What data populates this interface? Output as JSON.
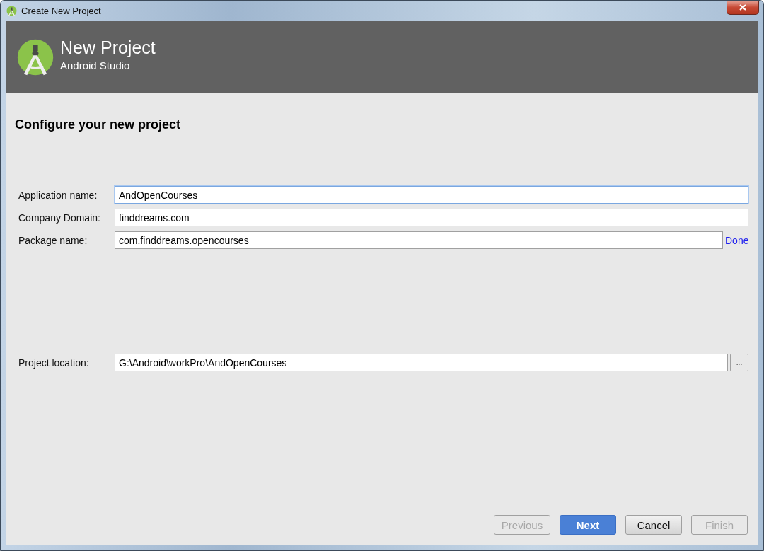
{
  "window": {
    "title": "Create New Project"
  },
  "header": {
    "title": "New Project",
    "subtitle": "Android Studio"
  },
  "page_title": "Configure your new project",
  "fields": [
    {
      "label": "Application name:",
      "value": "AndOpenCourses",
      "focused": true
    },
    {
      "label": "Company Domain:",
      "value": "finddreams.com",
      "focused": false
    },
    {
      "label": "Package name:",
      "value": "com.finddreams.opencourses",
      "focused": false,
      "link": "Done"
    }
  ],
  "location": {
    "label": "Project location:",
    "value": "G:\\Android\\workPro\\AndOpenCourses",
    "focused": false,
    "browse_button": "..."
  },
  "buttons": [
    {
      "label": "Previous",
      "disabled": true,
      "default": false
    },
    {
      "label": "Next",
      "disabled": false,
      "default": true
    },
    {
      "label": "Cancel",
      "disabled": false,
      "default": false
    },
    {
      "label": "Finish",
      "disabled": true,
      "default": false
    }
  ]
}
